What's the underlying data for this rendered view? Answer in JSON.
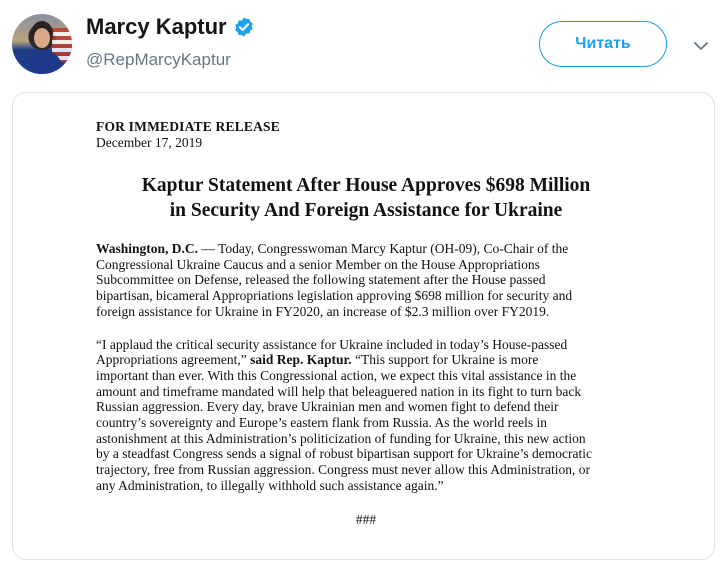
{
  "header": {
    "name": "Marcy Kaptur",
    "handle": "@RepMarcyKaptur",
    "follow_label": "Читать",
    "avatar_icon": "profile-photo",
    "verified_icon": "verified-badge-icon",
    "caret_icon": "chevron-down-icon",
    "accent_color": "#1da1f2"
  },
  "document": {
    "release_label": "FOR IMMEDIATE RELEASE",
    "date": "December 17, 2019",
    "title_line1": "Kaptur Statement After House Approves $698 Million",
    "title_line2": "in Security And Foreign Assistance for Ukraine",
    "p1_location": "Washington, D.C.",
    "p1_line1": " — Today, Congresswoman Marcy Kaptur (OH-09), Co-Chair of the",
    "p1_line2": "Congressional Ukraine Caucus and a senior Member on the House Appropriations",
    "p1_line3": "Subcommittee on Defense, released the following statement after the House passed",
    "p1_line4": "bipartisan, bicameral Appropriations legislation approving $698 million for security and",
    "p1_line5": "foreign assistance for Ukraine in FY2020, an increase of $2.3 million over FY2019.",
    "p2_line1": "“I applaud the critical security assistance for Ukraine included in today’s House-passed",
    "p2_line2_a": "Appropriations agreement,” ",
    "p2_line2_b": "said Rep. Kaptur.",
    "p2_line2_c": " “This support for Ukraine is more",
    "p2_line3": "important than ever. With this Congressional action, we expect this vital assistance in the",
    "p2_line4": "amount and timeframe mandated will help that beleaguered nation in its fight to turn back",
    "p2_line5": "Russian aggression. Every day, brave Ukrainian men and women fight to defend their",
    "p2_line6": "country’s sovereignty and Europe’s eastern flank from Russia. As the world reels in",
    "p2_line7": "astonishment at this Administration’s politicization of funding for Ukraine, this new action",
    "p2_line8": "by a steadfast Congress sends a signal of robust bipartisan support for Ukraine’s democratic",
    "p2_line9": "trajectory, free from Russian aggression. Congress must never allow this Administration, or",
    "p2_line10": "any Administration, to illegally withhold such assistance again.”",
    "end_mark": "###"
  }
}
